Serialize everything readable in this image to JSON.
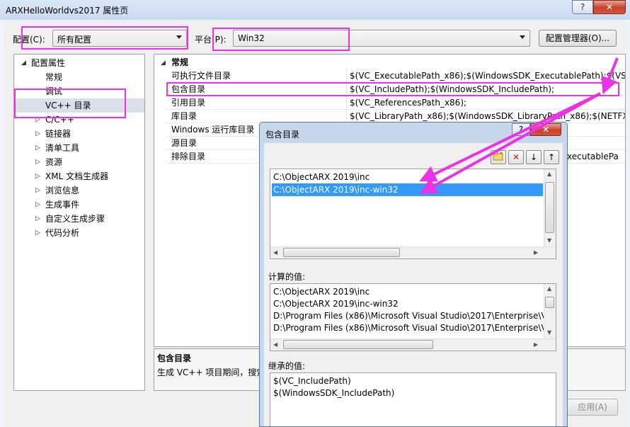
{
  "window": {
    "title": "ARXHelloWorldvs2017 属性页",
    "help": "?",
    "close": "✕"
  },
  "toolbar": {
    "config_label": "配置(C):",
    "config_value": "所有配置",
    "platform_label": "平台(P):",
    "platform_value": "Win32",
    "config_manager": "配置管理器(O)..."
  },
  "tree": {
    "root": "配置属性",
    "items": [
      "常规",
      "调试",
      "VC++ 目录",
      "C/C++",
      "链接器",
      "清单工具",
      "资源",
      "XML 文档生成器",
      "浏览信息",
      "生成事件",
      "自定义生成步骤",
      "代码分析"
    ],
    "selected": "VC++ 目录"
  },
  "grid": {
    "section": "常规",
    "rows": [
      {
        "name": "可执行文件目录",
        "value": "$(VC_ExecutablePath_x86);$(WindowsSDK_ExecutablePath);$(VS_E"
      },
      {
        "name": "包含目录",
        "value": "$(VC_IncludePath);$(WindowsSDK_IncludePath);"
      },
      {
        "name": "引用目录",
        "value": "$(VC_ReferencesPath_x86);"
      },
      {
        "name": "库目录",
        "value": "$(VC_LibraryPath_x86);$(WindowsSDK_LibraryPath_x86);$(NETFXK"
      },
      {
        "name": "Windows 运行库目录",
        "value": ""
      },
      {
        "name": "源目录",
        "value": ""
      },
      {
        "name": "排除目录",
        "value": "xecutablePa"
      }
    ]
  },
  "description": {
    "title": "包含目录",
    "text": "生成 VC++ 项目期间，搜索"
  },
  "apply_button": "应用(A)",
  "dialog": {
    "title": "包含目录",
    "help": "?",
    "close": "✕",
    "paths": [
      "C:\\ObjectARX 2019\\inc",
      "C:\\ObjectARX 2019\\inc-win32"
    ],
    "selected_index": 1,
    "computed_label": "计算的值:",
    "computed": [
      "C:\\ObjectARX 2019\\inc",
      "C:\\ObjectARX 2019\\inc-win32",
      "D:\\Program Files (x86)\\Microsoft Visual Studio\\2017\\Enterprise\\V",
      "D:\\Program Files (x86)\\Microsoft Visual Studio\\2017\\Enterprise\\V"
    ],
    "inherited_label": "继承的值:",
    "inherited": [
      "$(VC_IncludePath)",
      "$(WindowsSDK_IncludePath)"
    ]
  },
  "colors": {
    "highlight": "#ea33e6",
    "selection": "#3399ff"
  }
}
